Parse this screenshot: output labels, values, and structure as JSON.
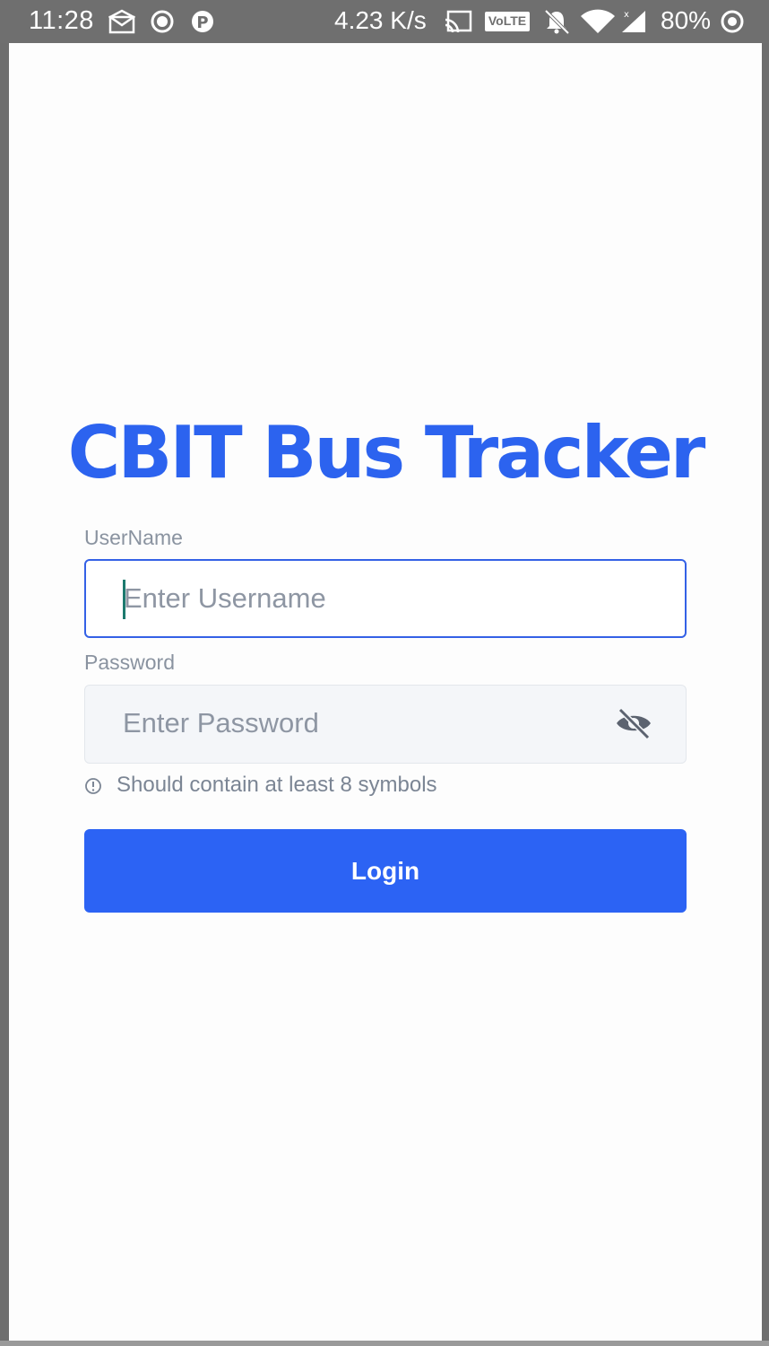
{
  "status_bar": {
    "time": "11:28",
    "network_speed": "4.23 K/s",
    "volte_label": "VoLTE",
    "battery": "80%",
    "icons": [
      "envelope-icon",
      "record-icon",
      "p-app-icon",
      "cast-icon",
      "volte-icon",
      "mute-icon",
      "wifi-icon",
      "signal-icon",
      "battery-icon"
    ]
  },
  "app": {
    "title": "CBIT Bus Tracker",
    "username": {
      "label": "UserName",
      "placeholder": "Enter Username",
      "value": ""
    },
    "password": {
      "label": "Password",
      "placeholder": "Enter Password",
      "value": "",
      "toggle_icon": "eye-off-icon"
    },
    "hint": {
      "icon": "info-icon",
      "text": "Should contain at least 8 symbols"
    },
    "login_label": "Login"
  },
  "colors": {
    "accent": "#2c63f4",
    "title": "#2c63ef",
    "status_bar": "#6f6f6f",
    "placeholder": "#8e96a3"
  }
}
